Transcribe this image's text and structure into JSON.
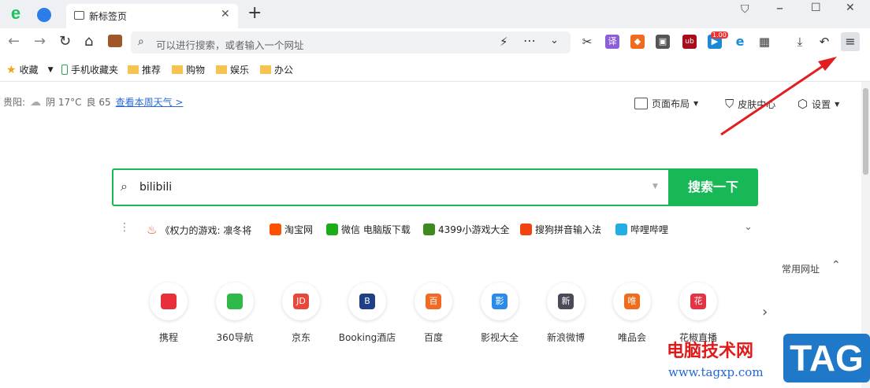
{
  "tab": {
    "title": "新标签页"
  },
  "address": {
    "placeholder": "可以进行搜索，或者输入一个网址"
  },
  "extensions": {
    "badge": "1.00",
    "translate": "译"
  },
  "bookmarks": [
    {
      "label": "收藏",
      "kind": "star"
    },
    {
      "label": "手机收藏夹",
      "kind": "phone"
    },
    {
      "label": "推荐",
      "kind": "folder"
    },
    {
      "label": "购物",
      "kind": "folder"
    },
    {
      "label": "娱乐",
      "kind": "folder"
    },
    {
      "label": "办公",
      "kind": "folder"
    }
  ],
  "weather": {
    "city": "贵阳:",
    "condition": "阴 17°C",
    "aqi": "良 65",
    "link": "查看本周天气 >"
  },
  "page_controls": {
    "layout": "页面布局",
    "skin": "皮肤中心",
    "settings": "设置"
  },
  "search": {
    "value": "bilibili",
    "button": "搜索一下"
  },
  "hot_links": [
    {
      "label": "《权力的游戏: 凛冬将",
      "color": "#ef4a2c"
    },
    {
      "label": "淘宝网",
      "color": "#ff5000"
    },
    {
      "label": "微信 电脑版下载",
      "color": "#1aad19"
    },
    {
      "label": "4399小游戏大全",
      "color": "#3d8b1f"
    },
    {
      "label": "搜狗拼音输入法",
      "color": "#f0430f"
    },
    {
      "label": "哔哩哔哩",
      "color": "#23ade5"
    }
  ],
  "sites_title": "常用网址",
  "sites": [
    {
      "label": "携程",
      "glyph": "",
      "color": "#e8303a"
    },
    {
      "label": "360导航",
      "glyph": "",
      "color": "#2fb94a"
    },
    {
      "label": "京东",
      "glyph": "JD",
      "color": "#e9473c"
    },
    {
      "label": "Booking酒店",
      "glyph": "B",
      "color": "#1f3f86"
    },
    {
      "label": "百度",
      "glyph": "百",
      "color": "#f06a23"
    },
    {
      "label": "影视大全",
      "glyph": "影",
      "color": "#2b8be8"
    },
    {
      "label": "新浪微博",
      "glyph": "新",
      "color": "#4b4b57"
    },
    {
      "label": "唯品会",
      "glyph": "唯",
      "color": "#f06b1c"
    },
    {
      "label": "花椒直播",
      "glyph": "花",
      "color": "#e53346"
    }
  ],
  "watermark": {
    "text": "电脑技术网",
    "url": "www.tagxp.com",
    "tag": "TAG"
  }
}
